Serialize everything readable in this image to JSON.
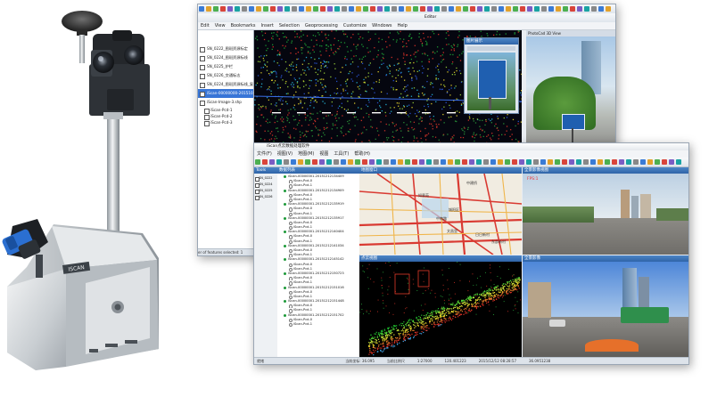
{
  "colors": {
    "accent": "#2f64a8",
    "selection": "#3875d7",
    "pointcloud_red": "#e2332a",
    "pointcloud_green": "#32c24a",
    "map_road": "#d93a32"
  },
  "gis_window": {
    "menu": [
      "Edit",
      "View",
      "Bookmarks",
      "Insert",
      "Selection",
      "Geoprocessing",
      "Customize",
      "Windows",
      "Help"
    ],
    "editor_label": "Editor",
    "layers": [
      {
        "label": "SN_0222_图斑资源标定",
        "type": "layer"
      },
      {
        "label": "SN_0224_图斑资源标线",
        "type": "layer"
      },
      {
        "label": "SN_0225_护栏",
        "type": "layer"
      },
      {
        "label": "SN_0226_交通标志",
        "type": "layer"
      },
      {
        "label": "SN_0224_图斑资源标线_复",
        "type": "layer"
      },
      {
        "label": "iScan-00000000-20151020115",
        "type": "selected"
      },
      {
        "label": "iScan-Image-3.shp",
        "type": "layer"
      },
      {
        "label": "iScan-Pcd-1",
        "type": "sub"
      },
      {
        "label": "iScan-Pcd-2",
        "type": "sub"
      },
      {
        "label": "iScan-Pcd-3",
        "type": "sub"
      }
    ],
    "status_text": "er of features selected: 1",
    "photo_panel_title": "PhotoCad 3D View",
    "sign_popup_title": "图片展示"
  },
  "app_window": {
    "title": "iScan点云数据处理软件",
    "menu": [
      "文件(F)",
      "视图(V)",
      "地图(M)",
      "视图",
      "工具(T)",
      "帮助(H)"
    ],
    "tree_panel_title": "数据列表",
    "side_panel_title": "Tools",
    "side_items": [
      "SN_0222",
      "SN_0224",
      "SN_0225",
      "SN_0226"
    ],
    "map_panel_title": "地图窗口",
    "map_labels": [
      "中建桥",
      "如意苑",
      "中南路",
      "城阳区",
      "文昌里",
      "日日新村",
      "东部新村"
    ],
    "pano_panel_title": "全景影像视图",
    "pano_label": "FPS:1",
    "cloud_panel_title": "点云视图",
    "street_panel_title": "全景影像",
    "tree_items": [
      {
        "label": "iScan-00000001-20151212134409",
        "level": "parent"
      },
      {
        "label": "iScan-Pcd-0",
        "level": "child"
      },
      {
        "label": "iScan-Pcd-1",
        "level": "child"
      },
      {
        "label": "iScan-00000001-20151212134909",
        "level": "parent"
      },
      {
        "label": "iScan-Pcd-0",
        "level": "child"
      },
      {
        "label": "iScan-Pcd-1",
        "level": "child"
      },
      {
        "label": "iScan-00000001-20151212135919",
        "level": "parent"
      },
      {
        "label": "iScan-Pcd-0",
        "level": "child"
      },
      {
        "label": "iScan-Pcd-1",
        "level": "child"
      },
      {
        "label": "iScan-00000001-20151212135917",
        "level": "parent"
      },
      {
        "label": "iScan-Pcd-0",
        "level": "child"
      },
      {
        "label": "iScan-Pcd-1",
        "level": "child"
      },
      {
        "label": "iScan-00000001-20151212140404",
        "level": "parent"
      },
      {
        "label": "iScan-Pcd-0",
        "level": "child"
      },
      {
        "label": "iScan-Pcd-1",
        "level": "child"
      },
      {
        "label": "iScan-00000001-20151212141034",
        "level": "parent"
      },
      {
        "label": "iScan-Pcd-0",
        "level": "child"
      },
      {
        "label": "iScan-Pcd-1",
        "level": "child"
      },
      {
        "label": "iScan-00000001-20151212145142",
        "level": "parent"
      },
      {
        "label": "iScan-Pcd-0",
        "level": "child"
      },
      {
        "label": "iScan-Pcd-1",
        "level": "child"
      },
      {
        "label": "iScan-00000001-20151212150723",
        "level": "parent"
      },
      {
        "label": "iScan-Pcd-0",
        "level": "child"
      },
      {
        "label": "iScan-Pcd-1",
        "level": "child"
      },
      {
        "label": "iScan-00000001-20151212151016",
        "level": "parent"
      },
      {
        "label": "iScan-Pcd-0",
        "level": "child"
      },
      {
        "label": "iScan-Pcd-1",
        "level": "child"
      },
      {
        "label": "iScan-00000001-20151212151448",
        "level": "parent"
      },
      {
        "label": "iScan-Pcd-0",
        "level": "child"
      },
      {
        "label": "iScan-Pcd-1",
        "level": "child"
      },
      {
        "label": "iScan-00000001-20151212151702",
        "level": "parent"
      },
      {
        "label": "iScan-Pcd-0",
        "level": "child"
      },
      {
        "label": "iScan-Pcd-1",
        "level": "child"
      }
    ],
    "status_left": "就绪",
    "status_items": [
      "当前坐标: 36.095",
      "当前比例尺",
      "1:27000",
      "120.401223",
      "2015/12/12 08:28:57",
      "36.0951238"
    ]
  },
  "device": {
    "badge_text": "ISCAN"
  }
}
